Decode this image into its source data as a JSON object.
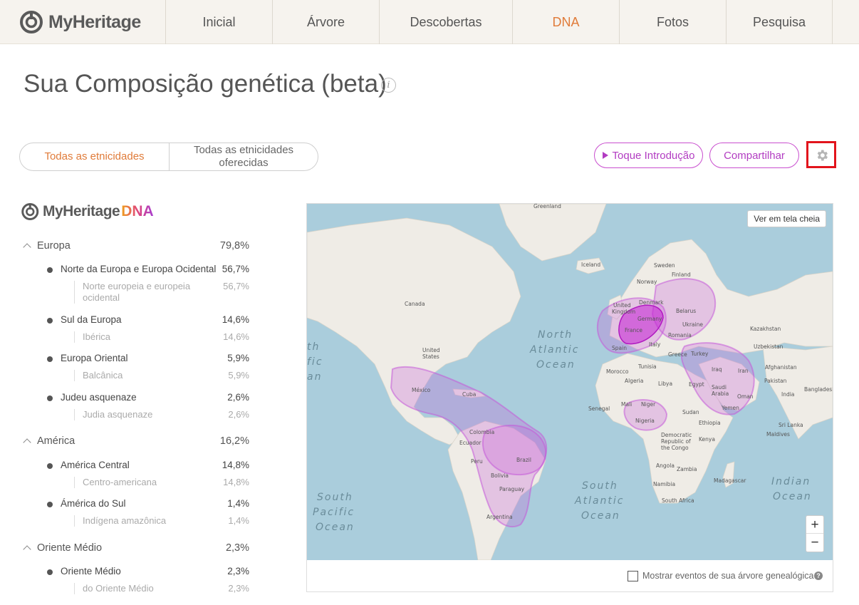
{
  "header": {
    "logo_text": "MyHeritage",
    "nav": [
      {
        "label": "Inicial",
        "active": false
      },
      {
        "label": "Árvore",
        "active": false
      },
      {
        "label": "Descobertas",
        "active": false
      },
      {
        "label": "DNA",
        "active": true
      },
      {
        "label": "Fotos",
        "active": false
      },
      {
        "label": "Pesquisa",
        "active": false
      }
    ]
  },
  "page": {
    "title": "Sua Composição genética (beta)",
    "info_icon": "i"
  },
  "tabs": {
    "all": "Todas as etnicidades",
    "offered": "Todas as etnicidades oferecidas"
  },
  "actions": {
    "tour_label": "Toque Introdução",
    "share_label": "Compartilhar",
    "settings_icon": "gear-icon"
  },
  "dna_logo": {
    "brand": "MyHeritage",
    "product": "DNA"
  },
  "ethnicities": [
    {
      "name": "Europa",
      "pct": "79,8%",
      "subs": [
        {
          "name": "Norte da Europa e Europa Ocidental",
          "pct": "56,7%",
          "leaf": "Norte europeia e europeia ocidental",
          "leaf_pct": "56,7%"
        },
        {
          "name": "Sul da Europa",
          "pct": "14,6%",
          "leaf": "Ibérica",
          "leaf_pct": "14,6%"
        },
        {
          "name": "Europa Oriental",
          "pct": "5,9%",
          "leaf": "Balcânica",
          "leaf_pct": "5,9%"
        },
        {
          "name": "Judeu asquenaze",
          "pct": "2,6%",
          "leaf": "Judia asquenaze",
          "leaf_pct": "2,6%"
        }
      ]
    },
    {
      "name": "América",
      "pct": "16,2%",
      "subs": [
        {
          "name": "América Central",
          "pct": "14,8%",
          "leaf": "Centro-americana",
          "leaf_pct": "14,8%"
        },
        {
          "name": "Ámérica do Sul",
          "pct": "1,4%",
          "leaf": "Indígena amazônica",
          "leaf_pct": "1,4%"
        }
      ]
    },
    {
      "name": "Oriente Médio",
      "pct": "2,3%",
      "subs": [
        {
          "name": "Oriente Médio",
          "pct": "2,3%",
          "leaf": "do Oriente Médio",
          "leaf_pct": "2,3%"
        }
      ]
    }
  ],
  "map": {
    "fullscreen_label": "Ver em tela cheia",
    "zoom_in": "+",
    "zoom_out": "−",
    "show_events_label": "Mostrar eventos de sua árvore genealógica",
    "help_icon": "?",
    "ocean_labels": {
      "north_atlantic": [
        "North",
        "Atlantic",
        "Ocean"
      ],
      "south_atlantic": [
        "South",
        "Atlantic",
        "Ocean"
      ],
      "south_pacific": [
        "South",
        "Pacific",
        "Ocean"
      ],
      "indian": [
        "Indian",
        "Ocean"
      ],
      "edge_pacific": [
        "th",
        "fic",
        "an"
      ]
    },
    "place_labels": [
      "Greenland",
      "Iceland",
      "Sweden",
      "Finland",
      "Norway",
      "Canada",
      "United Kingdom",
      "Denmark",
      "Belarus",
      "Germany",
      "Ukraine",
      "France",
      "Romania",
      "Kazakhstan",
      "Spain",
      "Italy",
      "Uzbekistan",
      "Greece",
      "Turkey",
      "United States",
      "Afghanistan",
      "Tunisia",
      "Morocco",
      "Iraq",
      "Iran",
      "Algeria",
      "Libya",
      "Egypt",
      "Saudi Arabia",
      "Pakistan",
      "México",
      "Cuba",
      "Oman",
      "India",
      "Bangladesh",
      "Mali",
      "Niger",
      "Sudan",
      "Yemen",
      "Senegal",
      "Nigeria",
      "Ethiopia",
      "Sri Lanka",
      "Colombia",
      "Maldives",
      "Democratic Republic of the Congo",
      "Kenya",
      "Ecuador",
      "Brazil",
      "Peru",
      "Angola",
      "Bolivia",
      "Zambia",
      "Madagascar",
      "Paraguay",
      "Namibia",
      "South Africa",
      "Argentina"
    ]
  }
}
